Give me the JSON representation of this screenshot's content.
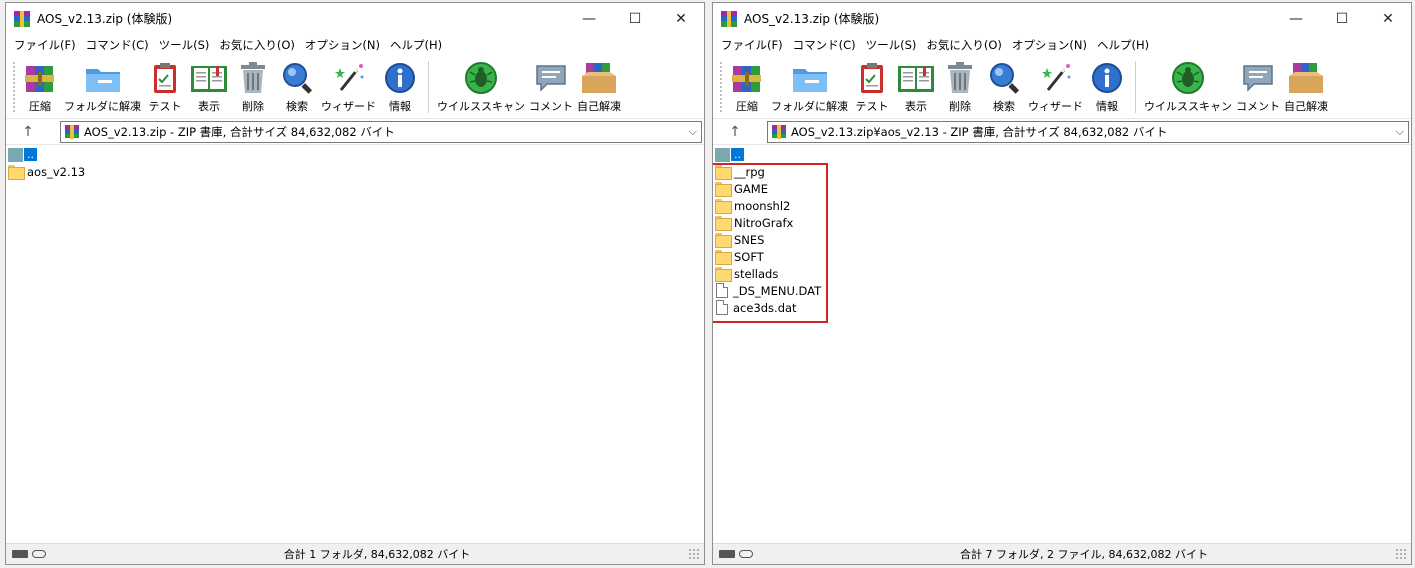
{
  "left": {
    "title": "AOS_v2.13.zip (体験版)",
    "address": "AOS_v2.13.zip - ZIP 書庫, 合計サイズ 84,632,082 バイト",
    "parent_label": "..",
    "files": [
      {
        "name": "aos_v2.13",
        "type": "folder"
      }
    ],
    "status": "合計 1 フォルダ, 84,632,082 バイト"
  },
  "right": {
    "title": "AOS_v2.13.zip (体験版)",
    "address": "AOS_v2.13.zip¥aos_v2.13 - ZIP 書庫, 合計サイズ 84,632,082 バイト",
    "parent_label": "..",
    "files": [
      {
        "name": "__rpg",
        "type": "folder"
      },
      {
        "name": "GAME",
        "type": "folder"
      },
      {
        "name": "moonshl2",
        "type": "folder"
      },
      {
        "name": "NitroGrafx",
        "type": "folder"
      },
      {
        "name": "SNES",
        "type": "folder"
      },
      {
        "name": "SOFT",
        "type": "folder"
      },
      {
        "name": "stellads",
        "type": "folder"
      },
      {
        "name": "_DS_MENU.DAT",
        "type": "file"
      },
      {
        "name": "ace3ds.dat",
        "type": "file"
      }
    ],
    "status": "合計 7 フォルダ, 2 ファイル, 84,632,082 バイト"
  },
  "menu": [
    "ファイル(F)",
    "コマンド(C)",
    "ツール(S)",
    "お気に入り(O)",
    "オプション(N)",
    "ヘルプ(H)"
  ],
  "toolbar": {
    "add": "圧縮",
    "extract": "フォルダに解凍",
    "test": "テスト",
    "view": "表示",
    "delete": "削除",
    "find": "検索",
    "wizard": "ウィザード",
    "info": "情報",
    "virus": "ウイルススキャン",
    "comment": "コメント",
    "sfx": "自己解凍"
  },
  "colors": {
    "highlight": "#d2222a",
    "selection": "#0078d7"
  }
}
